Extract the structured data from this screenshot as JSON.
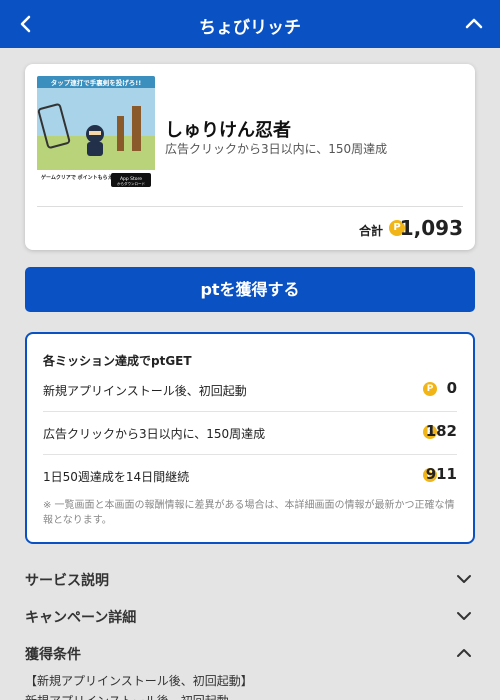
{
  "header": {
    "title": "ちょびリッチ",
    "back_icon": "chevron-left-icon",
    "collapse_icon": "chevron-up-icon"
  },
  "offer": {
    "app_name": "しゅりけん忍者",
    "description": "広告クリックから3日以内に、150周達成",
    "total_label": "合計",
    "total_value": "1,093",
    "coin_symbol": "P",
    "banner": {
      "headline": "タップ連打で手裏剣を投げろ!!",
      "footer": "ゲームクリアで\nポイントもらえる?!",
      "store_badge_top": "App Store",
      "store_badge_bottom": "からダウンロード"
    }
  },
  "cta": {
    "label": "ptを獲得する"
  },
  "missions": {
    "title": "各ミッション達成でptGET",
    "items": [
      {
        "label": "新規アプリインストール後、初回起動",
        "points": "0"
      },
      {
        "label": "広告クリックから3日以内に、150周達成",
        "points": "182"
      },
      {
        "label": "1日50週達成を14日間継続",
        "points": "911"
      }
    ],
    "note": "※ 一覧画面と本画面の報酬情報に差異がある場合は、本詳細画面の情報が最新かつ正確な情報となります。"
  },
  "accordion": [
    {
      "label": "サービス説明",
      "icon": "chevron-down-icon"
    },
    {
      "label": "キャンペーン詳細",
      "icon": "chevron-down-icon"
    },
    {
      "label": "獲得条件",
      "icon": "chevron-up-icon"
    }
  ],
  "conditions": [
    "【新規アプリインストール後、初回起動】",
    "新規アプリインストール後、初回起動"
  ],
  "colors": {
    "primary": "#0a52c4",
    "coin": "#f2b517",
    "background": "#e4e4e4"
  }
}
